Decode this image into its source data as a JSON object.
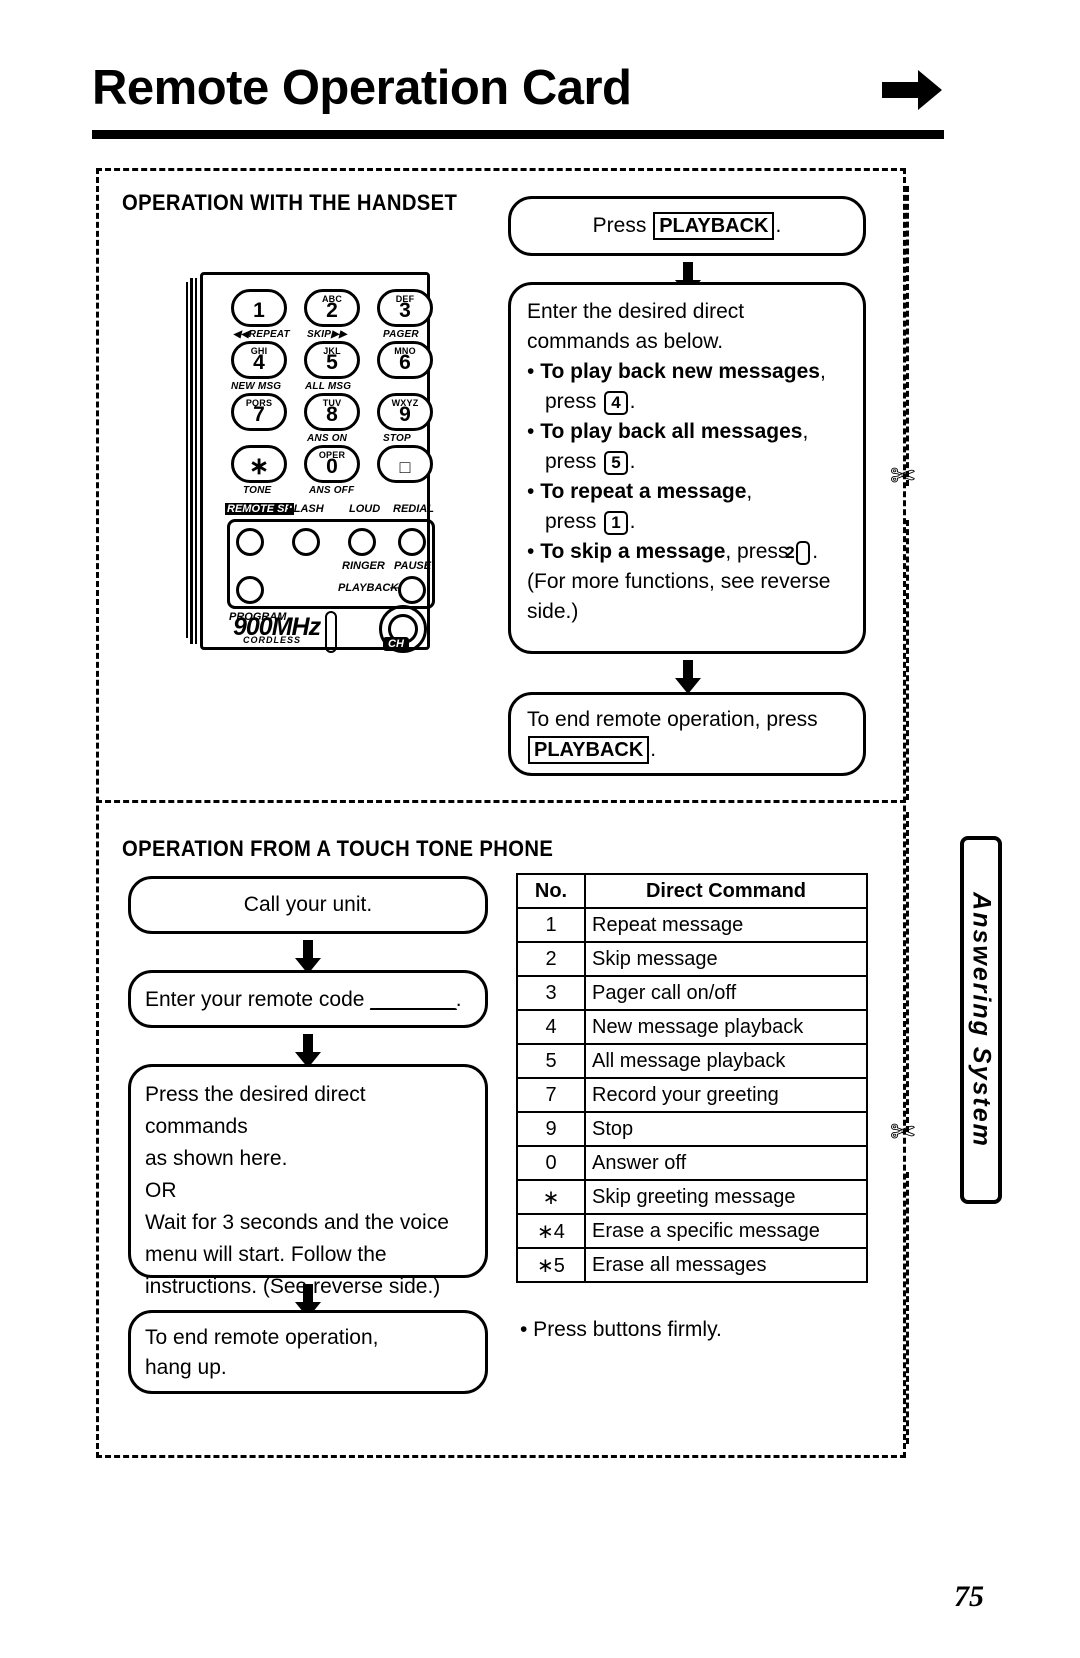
{
  "header": {
    "title": "Remote Operation Card",
    "arrow_icon": "right-arrow-icon"
  },
  "section1": {
    "heading": "OPERATION WITH THE HANDSET",
    "handset": {
      "keys": [
        {
          "digit": "1",
          "letters": "",
          "sub": "◀◀REPEAT"
        },
        {
          "digit": "2",
          "letters": "ABC",
          "sub": "SKIP▶▶"
        },
        {
          "digit": "3",
          "letters": "DEF",
          "sub": "PAGER"
        },
        {
          "digit": "4",
          "letters": "GHI",
          "sub": "NEW MSG"
        },
        {
          "digit": "5",
          "letters": "JKL",
          "sub": "ALL MSG"
        },
        {
          "digit": "6",
          "letters": "MNO",
          "sub": ""
        },
        {
          "digit": "7",
          "letters": "PQRS",
          "sub": ""
        },
        {
          "digit": "8",
          "letters": "TUV",
          "sub": "ANS ON"
        },
        {
          "digit": "9",
          "letters": "WXYZ",
          "sub": "STOP"
        },
        {
          "digit": "∗",
          "letters": "",
          "sub": "TONE"
        },
        {
          "digit": "0",
          "letters": "OPER",
          "sub": "ANS OFF"
        },
        {
          "digit": "□",
          "letters": "",
          "sub": ""
        }
      ],
      "function_labels": [
        "REMOTE SP",
        "FLASH",
        "LOUD",
        "REDIAL"
      ],
      "function_sublabels": [
        "RINGER",
        "PAUSE",
        "PLAYBACK",
        "PROGRAM"
      ],
      "brand": "900MHz",
      "brand_sub": "CORDLESS",
      "channel_badge": "CH"
    },
    "steps": {
      "step1_pre": "Press",
      "step1_key": "PLAYBACK",
      "step1_post": ".",
      "step2_intro_line1": "Enter the desired direct",
      "step2_intro_line2": "commands as below.",
      "bullets": [
        {
          "bold": "To play back new messages",
          "after": ",",
          "press_label": "press",
          "key": "4",
          "tail": "."
        },
        {
          "bold": "To play back all messages",
          "after": ",",
          "press_label": "press",
          "key": "5",
          "tail": "."
        },
        {
          "bold": "To repeat a message",
          "after": ",",
          "press_label": "press",
          "key": "1",
          "tail": "."
        },
        {
          "bold": "To skip a message",
          "after": ", press",
          "press_label": "",
          "key": "2",
          "tail": "."
        }
      ],
      "step2_note_line1": "(For more functions, see reverse",
      "step2_note_line2": "side.)",
      "step3_pre": "To end remote operation, press",
      "step3_key": "PLAYBACK",
      "step3_post": "."
    }
  },
  "section2": {
    "heading": "OPERATION FROM A TOUCH TONE PHONE",
    "steps": {
      "step1": "Call your unit.",
      "step2_pre": "Enter your remote code",
      "step2_blank": "________",
      "step2_post": ".",
      "step3_lines": [
        "Press the desired direct commands",
        "as shown here.",
        "OR",
        "Wait for 3 seconds and the voice",
        "menu will start. Follow the",
        "instructions. (See reverse side.)"
      ],
      "step4_lines": [
        "To end remote operation,",
        "hang up."
      ]
    },
    "table": {
      "headers": [
        "No.",
        "Direct Command"
      ],
      "rows": [
        {
          "no": "1",
          "command": "Repeat message"
        },
        {
          "no": "2",
          "command": "Skip message"
        },
        {
          "no": "3",
          "command": "Pager call on/off"
        },
        {
          "no": "4",
          "command": "New message playback"
        },
        {
          "no": "5",
          "command": "All message playback"
        },
        {
          "no": "7",
          "command": "Record your greeting"
        },
        {
          "no": "9",
          "command": "Stop"
        },
        {
          "no": "0",
          "command": "Answer off"
        },
        {
          "no": "∗",
          "command": "Skip greeting message"
        },
        {
          "no": "∗4",
          "command": "Erase a specific message"
        },
        {
          "no": "∗5",
          "command": "Erase all messages"
        }
      ]
    },
    "note": "• Press buttons firmly."
  },
  "side_tab": {
    "label": "Answering System"
  },
  "footer": {
    "page_number": "75"
  },
  "colors": {
    "ink": "#000000",
    "paper": "#ffffff"
  }
}
